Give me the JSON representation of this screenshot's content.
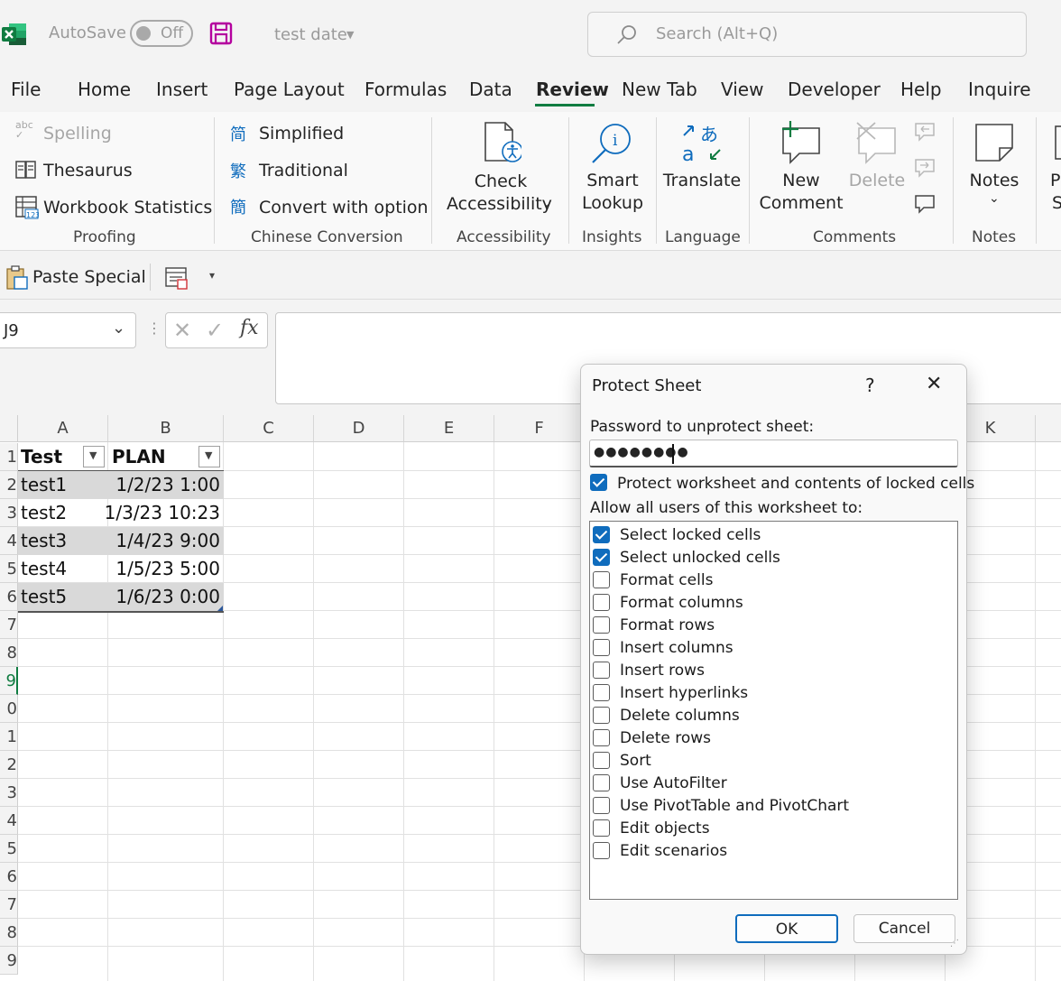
{
  "titlebar": {
    "autosave_label": "AutoSave",
    "autosave_state": "Off",
    "file_name": "test date",
    "search_placeholder": "Search (Alt+Q)"
  },
  "menu": [
    {
      "label": "File"
    },
    {
      "label": "Home"
    },
    {
      "label": "Insert"
    },
    {
      "label": "Page Layout"
    },
    {
      "label": "Formulas"
    },
    {
      "label": "Data"
    },
    {
      "label": "Review"
    },
    {
      "label": "New Tab"
    },
    {
      "label": "View"
    },
    {
      "label": "Developer"
    },
    {
      "label": "Help"
    },
    {
      "label": "Inquire"
    }
  ],
  "ribbon": {
    "proofing": {
      "spelling": "Spelling",
      "thesaurus": "Thesaurus",
      "workbook_statistics": "Workbook Statistics",
      "label": "Proofing"
    },
    "chinese": {
      "simplified": "Simplified",
      "traditional": "Traditional",
      "convert": "Convert with option",
      "label": "Chinese Conversion"
    },
    "accessibility": {
      "line1": "Check",
      "line2": "Accessibility",
      "label": "Accessibility"
    },
    "insights": {
      "line1": "Smart",
      "line2": "Lookup",
      "label": "Insights"
    },
    "language": {
      "translate": "Translate",
      "label": "Language"
    },
    "comments": {
      "new_line1": "New",
      "new_line2": "Comment",
      "delete": "Delete",
      "label": "Comments"
    },
    "notes": {
      "notes": "Notes",
      "label": "Notes"
    },
    "partial": {
      "line1": "P",
      "line2": "S"
    }
  },
  "qat": {
    "paste_special": "Paste Special"
  },
  "formula_bar": {
    "name_box": "J9",
    "fx": "fx"
  },
  "grid": {
    "columns": [
      "A",
      "B",
      "C",
      "D",
      "E",
      "F",
      "K"
    ],
    "rows": [
      "1",
      "2",
      "3",
      "4",
      "5",
      "6",
      "7",
      "8",
      "9",
      "0",
      "1",
      "2",
      "3",
      "4",
      "5",
      "6",
      "7",
      "8",
      "9"
    ],
    "headers": {
      "a": "Test",
      "b": "PLAN"
    },
    "data": [
      {
        "a": "test1",
        "b": "1/2/23 1:00"
      },
      {
        "a": "test2",
        "b": "1/3/23 10:23"
      },
      {
        "a": "test3",
        "b": "1/4/23 9:00"
      },
      {
        "a": "test4",
        "b": "1/5/23 5:00"
      },
      {
        "a": "test5",
        "b": "1/6/23 0:00"
      }
    ]
  },
  "dialog": {
    "title": "Protect Sheet",
    "help": "?",
    "password_label": "Password to unprotect sheet:",
    "password_value": "●●●●●●●●",
    "protect_label": "Protect worksheet and contents of locked cells",
    "protect_checked": true,
    "allow_label": "Allow all users of this worksheet to:",
    "permissions": [
      {
        "label": "Select locked cells",
        "checked": true
      },
      {
        "label": "Select unlocked cells",
        "checked": true
      },
      {
        "label": "Format cells",
        "checked": false
      },
      {
        "label": "Format columns",
        "checked": false
      },
      {
        "label": "Format rows",
        "checked": false
      },
      {
        "label": "Insert columns",
        "checked": false
      },
      {
        "label": "Insert rows",
        "checked": false
      },
      {
        "label": "Insert hyperlinks",
        "checked": false
      },
      {
        "label": "Delete columns",
        "checked": false
      },
      {
        "label": "Delete rows",
        "checked": false
      },
      {
        "label": "Sort",
        "checked": false
      },
      {
        "label": "Use AutoFilter",
        "checked": false
      },
      {
        "label": "Use PivotTable and PivotChart",
        "checked": false
      },
      {
        "label": "Edit objects",
        "checked": false
      },
      {
        "label": "Edit scenarios",
        "checked": false
      }
    ],
    "ok": "OK",
    "cancel": "Cancel"
  },
  "colors": {
    "accent_green": "#107c41",
    "checkbox_blue": "#0f6cbd",
    "band_gray": "#d9d9d9",
    "save_purple": "#b4009e"
  }
}
